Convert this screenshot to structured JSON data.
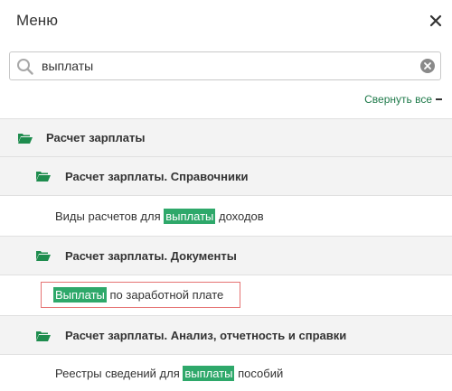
{
  "header": {
    "title": "Меню"
  },
  "search": {
    "value": "выплаты"
  },
  "collapse": {
    "label": "Свернуть все"
  },
  "tree": {
    "root": {
      "label": "Расчет зарплаты"
    },
    "group1": {
      "label": "Расчет зарплаты. Справочники"
    },
    "item1": {
      "pre": "Виды расчетов для ",
      "hl": "выплаты",
      "post": " доходов"
    },
    "group2": {
      "label": "Расчет зарплаты. Документы"
    },
    "item2": {
      "pre": "",
      "hl": "Выплаты",
      "post": " по заработной плате"
    },
    "group3": {
      "label": "Расчет зарплаты. Анализ, отчетность и справки"
    },
    "item3": {
      "pre": "Реестры сведений для ",
      "hl": "выплаты",
      "post": " пособий"
    }
  },
  "colors": {
    "accent": "#2ea86a",
    "link": "#1f7a4a",
    "folder": "#1e8c4e",
    "selection_border": "#e57373"
  },
  "icons": [
    "close-icon",
    "search-icon",
    "clear-icon",
    "folder-open-icon"
  ]
}
